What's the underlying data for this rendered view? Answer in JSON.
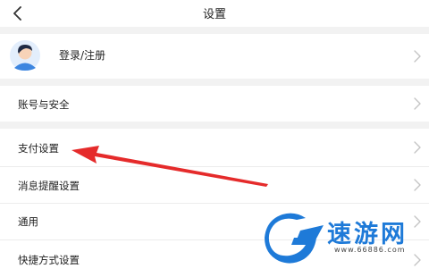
{
  "header": {
    "title": "设置"
  },
  "profile": {
    "label": "登录/注册"
  },
  "settings": [
    {
      "label": "账号与安全"
    },
    {
      "label": "支付设置"
    },
    {
      "label": "消息提醒设置"
    },
    {
      "label": "通用"
    },
    {
      "label": "快捷方式设置"
    }
  ],
  "watermark": {
    "name": "速游网",
    "url": "www.66886.com"
  },
  "colors": {
    "arrow": "#e52b2b",
    "brand": "#1e7ad8",
    "background": "#f2f2f2"
  },
  "icons": [
    "back-arrow-icon",
    "user-avatar-icon",
    "chevron-right-icon",
    "red-annotation-arrow",
    "suyou-logo-icon"
  ]
}
